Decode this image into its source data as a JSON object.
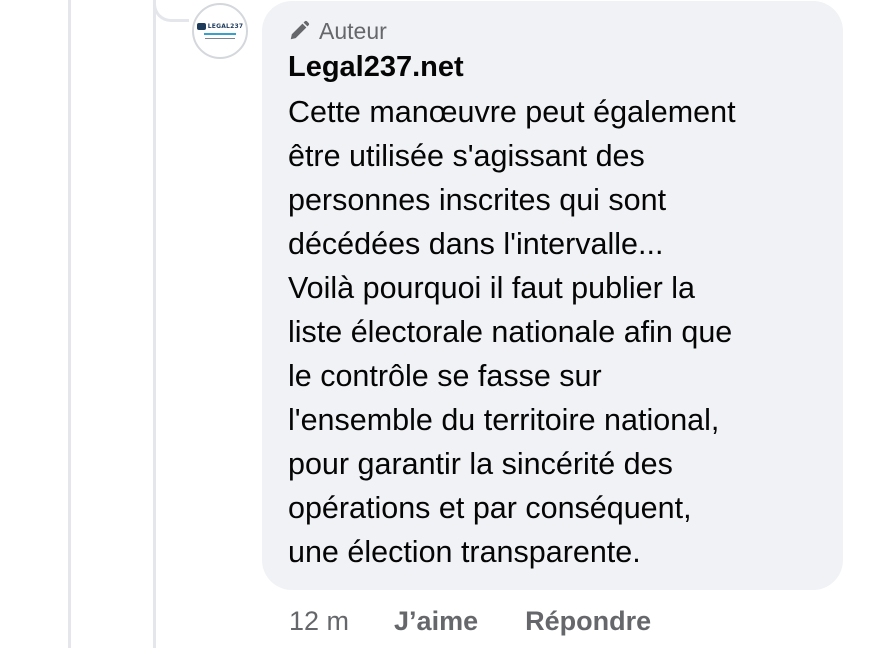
{
  "comment": {
    "badge_label": "Auteur",
    "badge_icon": "pencil-icon",
    "author_name": "Legal237.net",
    "avatar_logo_text": "LEGAL237",
    "text": "Cette manœuvre peut également\nêtre utilisée s'agissant des\npersonnes inscrites qui sont\ndécédées dans l'intervalle...\nVoilà pourquoi il faut publier la\nliste électorale nationale afin que\nle contrôle se fasse sur\nl'ensemble du territoire national,\npour garantir la sincérité des\nopérations et par conséquent,\nune élection transparente.",
    "bubble_color": "#f0f2f5",
    "text_color": "#050505",
    "meta_color": "#65676b"
  },
  "actions": {
    "timestamp": "12 m",
    "like_label": "J’aime",
    "reply_label": "Répondre"
  }
}
